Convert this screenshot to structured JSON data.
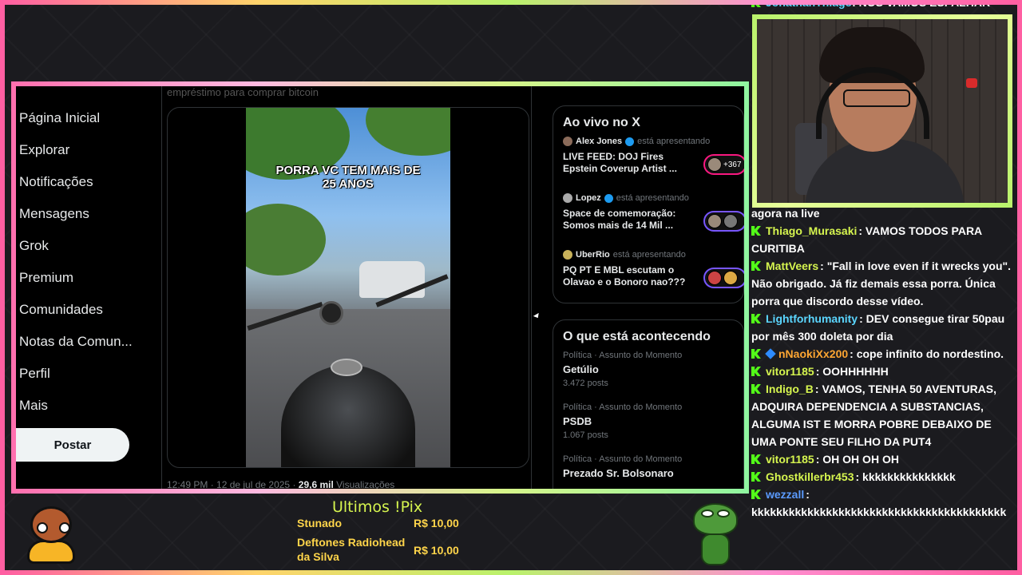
{
  "x_nav": {
    "items": [
      "Página Inicial",
      "Explorar",
      "Notificações",
      "Mensagens",
      "Grok",
      "Premium",
      "Comunidades",
      "Notas da Comun...",
      "Perfil",
      "Mais"
    ],
    "post_label": "Postar"
  },
  "feed": {
    "faded_text": "empréstimo para comprar bitcoin",
    "video_caption_line1": "PORRA VC TEM MAIS DE",
    "video_caption_line2": "25 ANOS",
    "meta_time": "12:49 PM · 12 de jul de 2025 · ",
    "meta_views": "29,6 mil",
    "meta_views_label": " Visualizações"
  },
  "live": {
    "title": "Ao vivo no X",
    "items": [
      {
        "host": "Alex Jones",
        "status": "está apresentando",
        "title": "LIVE FEED: DOJ Fires Epstein Coverup Artist ...",
        "count": "+367"
      },
      {
        "host": "Lopez",
        "status": "está apresentando",
        "title": "Space de comemoração: Somos mais de 14 Mil ...",
        "count": ""
      },
      {
        "host": "UberRio",
        "status": "está apresentando",
        "title": "PQ PT E MBL escutam o Olavao e o Bonoro nao???",
        "count": ""
      }
    ]
  },
  "trends": {
    "title": "O que está acontecendo",
    "items": [
      {
        "category": "Política · Assunto do Momento",
        "name": "Getúlio",
        "count": "3.472 posts"
      },
      {
        "category": "Política · Assunto do Momento",
        "name": "PSDB",
        "count": "1.067 posts"
      },
      {
        "category": "Política · Assunto do Momento",
        "name": "Prezado Sr. Bolsonaro",
        "count": ""
      }
    ]
  },
  "chat": {
    "top_partial": {
      "user": "JonathanThiago",
      "text": ": NÓS VAMOS ESPALHAR"
    },
    "partial_text": "agora na live",
    "messages": [
      {
        "user": "Thiago_Murasaki",
        "color": "#d6f54f",
        "text": ": VAMOS TODOS PARA CURITIBA"
      },
      {
        "user": "MattVeers",
        "color": "#d6f54f",
        "text": ": \"Fall in love even if it wrecks you\". Não obrigado. Já fiz demais essa porra. Única porra que discordo desse vídeo."
      },
      {
        "user": "Lightforhumanity",
        "color": "#5bd6ff",
        "text": ": DEV consegue tirar 50pau por mês 300 doleta por dia"
      },
      {
        "user": "nNaokiXx200",
        "color": "#ffa632",
        "text": ": cope infinito do nordestino."
      },
      {
        "user": "vitor1185",
        "color": "#d6f54f",
        "text": ": OOHHHHHH"
      },
      {
        "user": "Indigo_B",
        "color": "#d6f54f",
        "text": ": VAMOS, TENHA 50 AVENTURAS, ADQUIRA DEPENDENCIA A SUBSTANCIAS, ALGUMA IST E MORRA POBRE DEBAIXO DE UMA PONTE SEU FILHO DA PUT4"
      },
      {
        "user": "vitor1185",
        "color": "#d6f54f",
        "text": ": OH OH OH OH"
      },
      {
        "user": "Ghostkillerbr453",
        "color": "#d6f54f",
        "text": ": kkkkkkkkkkkkkkk"
      },
      {
        "user": "wezzall",
        "color": "#5b9bff",
        "text": ": kkkkkkkkkkkkkkkkkkkkkkkkkkkkkkkkkkkkkkkkk"
      }
    ]
  },
  "pix": {
    "title": "Ultimos !Pix",
    "entries": [
      {
        "name": "Stunado",
        "amount": "R$ 10,00"
      },
      {
        "name_line1": "Deftones Radiohead",
        "name_line2": "da Silva",
        "amount": "R$ 10,00"
      }
    ]
  },
  "icons": {
    "kick": "kick-logo-icon",
    "verified": "verified-badge-icon"
  },
  "colors": {
    "accent_green": "#53fc18",
    "x_blue": "#1d9bf0",
    "pix_yellow": "#ffd54a"
  }
}
